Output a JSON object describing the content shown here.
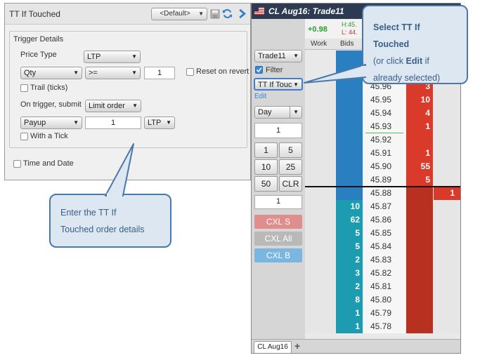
{
  "tt_panel": {
    "title": "TT If Touched",
    "template_value": "<Default>",
    "trigger_details_label": "Trigger Details",
    "price_type_label": "Price Type",
    "price_type_value": "LTP",
    "qty_value": "Qty",
    "operator_value": ">=",
    "qty_threshold": "1",
    "reset_on_revert_label": "Reset on revert",
    "trail_label": "Trail (ticks)",
    "on_trigger_label": "On trigger, submit",
    "on_trigger_value": "Limit order",
    "payup_value": "Payup",
    "payup_qty": "1",
    "payup_ref_value": "LTP",
    "with_tick_label": "With a Tick",
    "time_date_label": "Time and Date"
  },
  "book": {
    "title": "CL Aug16: Trade11",
    "account_value": "Trade11",
    "filter_label": "Filter",
    "filter_checked": true,
    "order_type_value": "TT If Touc",
    "edit_link": "Edit",
    "tif_value": "Day",
    "qty_field": "1",
    "qty_buttons": [
      "1",
      "5",
      "10",
      "25",
      "50",
      "CLR"
    ],
    "qty_field_2": "1",
    "cxl_sell": "CXL S",
    "cxl_all": "CXL All",
    "cxl_buy": "CXL B",
    "net_change": "+0.98",
    "high_label": "H:45.",
    "low_label": "L: 44.",
    "col_work": "Work",
    "col_bids": "Bids",
    "tab_label": "CL Aug16",
    "add_tab": "+",
    "ladder": [
      {
        "bid": "",
        "price": "45.96",
        "ask": "3",
        "extra": ""
      },
      {
        "bid": "",
        "price": "45.95",
        "ask": "10",
        "extra": ""
      },
      {
        "bid": "",
        "price": "45.94",
        "ask": "4",
        "extra": ""
      },
      {
        "bid": "",
        "price": "45.93",
        "ask": "1",
        "extra": ""
      },
      {
        "bid": "",
        "price": "45.92",
        "ask": "",
        "extra": ""
      },
      {
        "bid": "",
        "price": "45.91",
        "ask": "1",
        "extra": ""
      },
      {
        "bid": "",
        "price": "45.90",
        "ask": "55",
        "extra": ""
      },
      {
        "bid": "",
        "price": "45.89",
        "ask": "5",
        "extra": ""
      },
      {
        "bid": "",
        "price": "45.88",
        "ask": "",
        "extra": "1"
      },
      {
        "bid": "10",
        "price": "45.87",
        "ask": "",
        "extra": ""
      },
      {
        "bid": "62",
        "price": "45.86",
        "ask": "",
        "extra": ""
      },
      {
        "bid": "5",
        "price": "45.85",
        "ask": "",
        "extra": ""
      },
      {
        "bid": "5",
        "price": "45.84",
        "ask": "",
        "extra": ""
      },
      {
        "bid": "2",
        "price": "45.83",
        "ask": "",
        "extra": ""
      },
      {
        "bid": "3",
        "price": "45.82",
        "ask": "",
        "extra": ""
      },
      {
        "bid": "2",
        "price": "45.81",
        "ask": "",
        "extra": ""
      },
      {
        "bid": "8",
        "price": "45.80",
        "ask": "",
        "extra": ""
      },
      {
        "bid": "1",
        "price": "45.79",
        "ask": "",
        "extra": ""
      },
      {
        "bid": "1",
        "price": "45.78",
        "ask": "",
        "extra": ""
      }
    ]
  },
  "callouts": {
    "select_line1": "Select TT If Touched",
    "select_line2_pre": "(or click ",
    "select_line2_bold": "Edit",
    "select_line2_post": " if",
    "select_line3": "already selected)",
    "enter_line1": "Enter the TT If",
    "enter_line2": "Touched order details"
  },
  "colors": {
    "bid_blue": "#2a7fc0",
    "bid_teal": "#1d9bb0",
    "ask_red": "#d93a2a",
    "ask_dark": "#b83020",
    "title_bar": "#2c3b52",
    "callout_border": "#4a78a8",
    "callout_fill": "#dde7f1"
  }
}
